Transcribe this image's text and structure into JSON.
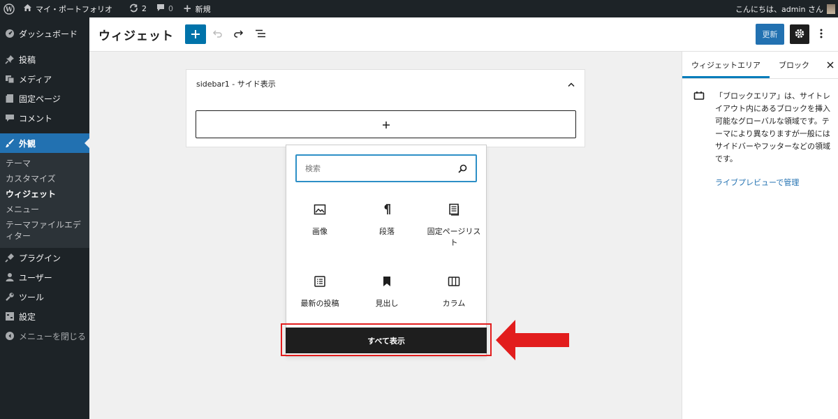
{
  "admin_bar": {
    "site_name": "マイ・ポートフォリオ",
    "updates_count": "2",
    "comments_count": "0",
    "new_label": "新規",
    "greeting": "こんにちは、admin さん"
  },
  "sidebar": {
    "items": [
      {
        "label": "ダッシュボード",
        "icon": "dashboard-icon"
      },
      {
        "label": "投稿",
        "icon": "pin-icon"
      },
      {
        "label": "メディア",
        "icon": "media-icon"
      },
      {
        "label": "固定ページ",
        "icon": "page-icon"
      },
      {
        "label": "コメント",
        "icon": "comment-icon"
      }
    ],
    "active": {
      "label": "外観",
      "icon": "brush-icon"
    },
    "submenu": [
      {
        "label": "テーマ"
      },
      {
        "label": "カスタマイズ"
      },
      {
        "label": "ウィジェット"
      },
      {
        "label": "メニュー"
      },
      {
        "label": "テーマファイルエディター"
      }
    ],
    "items_after": [
      {
        "label": "プラグイン",
        "icon": "plugin-icon"
      },
      {
        "label": "ユーザー",
        "icon": "user-icon"
      },
      {
        "label": "ツール",
        "icon": "wrench-icon"
      },
      {
        "label": "設定",
        "icon": "settings-icon"
      }
    ],
    "collapse_label": "メニューを閉じる"
  },
  "header": {
    "title": "ウィジェット",
    "update_label": "更新"
  },
  "widget_area": {
    "title": "sidebar1 - サイド表示"
  },
  "inserter": {
    "search_placeholder": "検索",
    "blocks": [
      {
        "label": "画像",
        "icon": "image-icon"
      },
      {
        "label": "段落",
        "icon": "paragraph-icon"
      },
      {
        "label": "固定ページリスト",
        "icon": "page-list-icon"
      },
      {
        "label": "最新の投稿",
        "icon": "latest-posts-icon"
      },
      {
        "label": "見出し",
        "icon": "heading-icon"
      },
      {
        "label": "カラム",
        "icon": "columns-icon"
      }
    ],
    "show_all_label": "すべて表示"
  },
  "right_panel": {
    "tabs": [
      {
        "label": "ウィジェットエリア"
      },
      {
        "label": "ブロック"
      }
    ],
    "description": "「ブロックエリア」は、サイトレイアウト内にあるブロックを挿入可能なグローバルな領域です。テーマにより異なりますが一般にはサイドバーやフッターなどの領域です。",
    "link_label": "ライブプレビューで管理"
  },
  "colors": {
    "admin_dark": "#1d2327",
    "accent_blue": "#2271b1",
    "highlight_red": "#e21d1d"
  }
}
